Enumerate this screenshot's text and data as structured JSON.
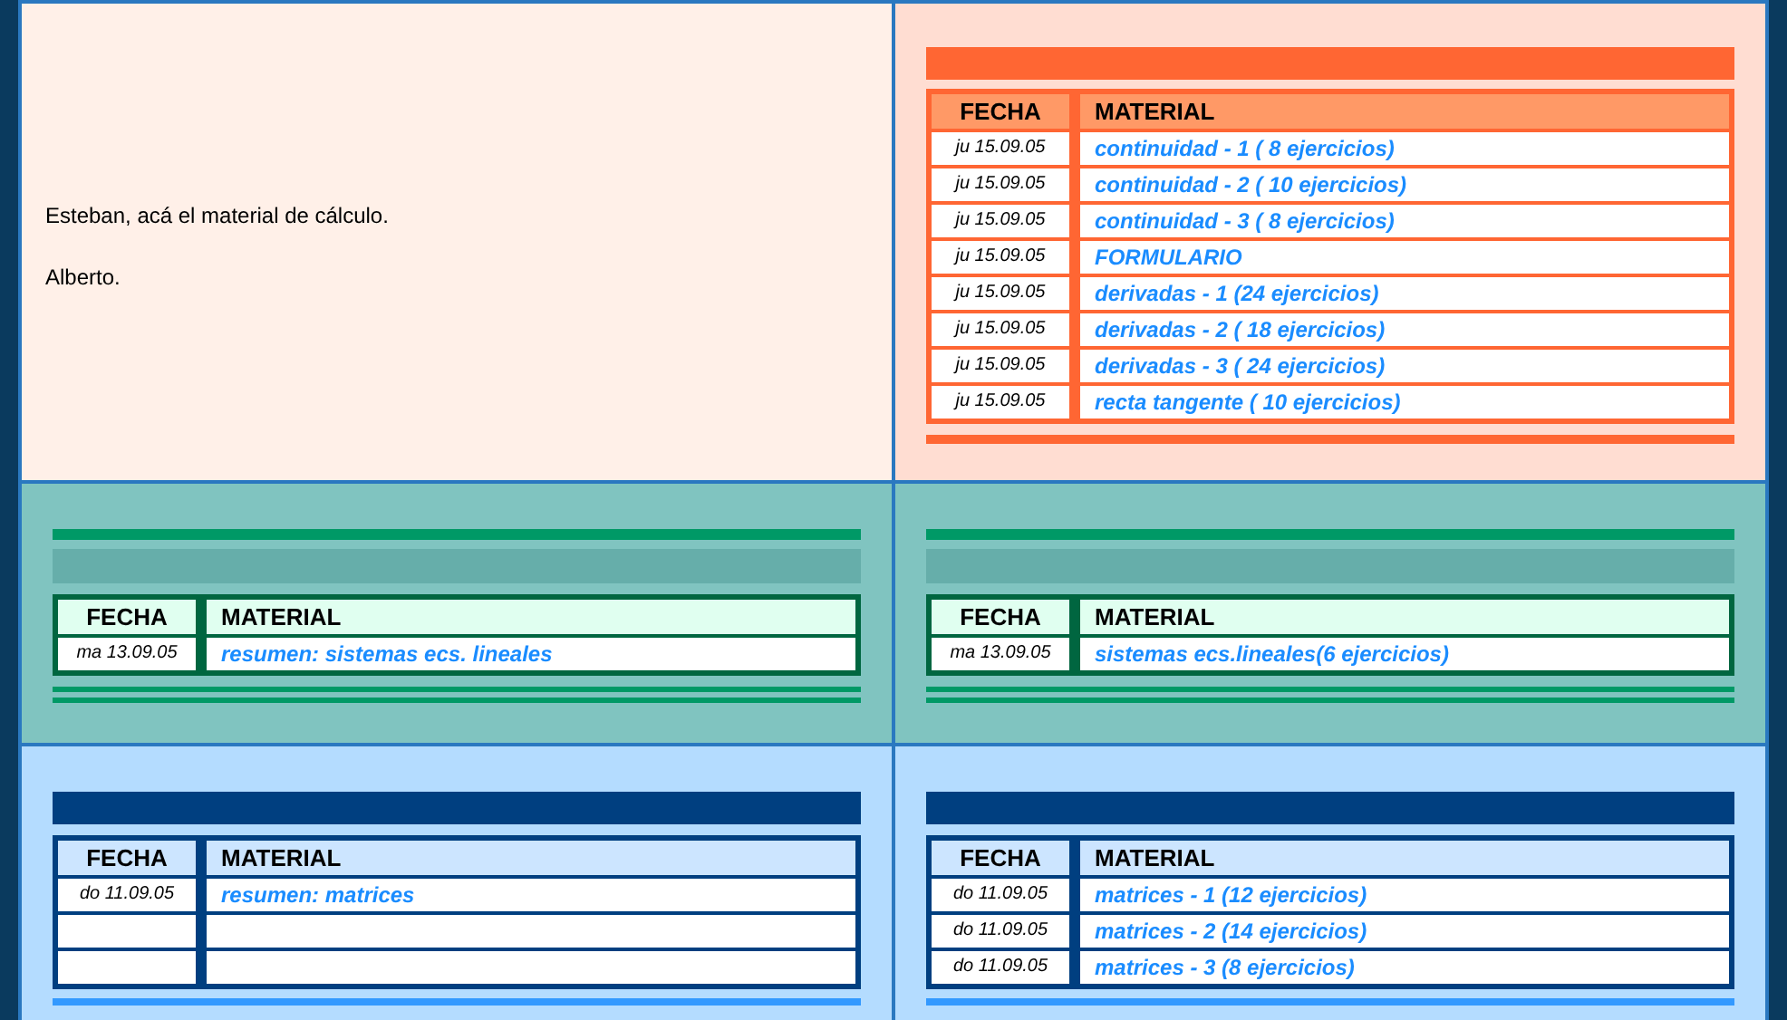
{
  "message": {
    "lines": [
      "Esteban, acá el material de cálculo.",
      "Alberto."
    ]
  },
  "panels": [
    {
      "kind": "orange",
      "columns": [
        "FECHA",
        "MATERIAL"
      ],
      "rows": [
        {
          "kind": "entry",
          "date": "ju 15.09.05",
          "material": "continuidad - 1 ( 8 ejercicios)"
        },
        {
          "kind": "entry",
          "date": "ju 15.09.05",
          "material": "continuidad - 2 ( 10 ejercicios)"
        },
        {
          "kind": "entry",
          "date": "ju 15.09.05",
          "material": "continuidad - 3 ( 8 ejercicios)"
        },
        {
          "kind": "entry",
          "date": "ju 15.09.05",
          "material": "FORMULARIO"
        },
        {
          "kind": "entry",
          "date": "ju 15.09.05",
          "material": "derivadas - 1 (24 ejercicios)"
        },
        {
          "kind": "entry",
          "date": "ju 15.09.05",
          "material": "derivadas - 2 ( 18 ejercicios)"
        },
        {
          "kind": "entry",
          "date": "ju 15.09.05",
          "material": "derivadas - 3 ( 24 ejercicios)"
        },
        {
          "kind": "entry",
          "date": "ju 15.09.05",
          "material": "recta tangente ( 10 ejercicios)"
        }
      ]
    },
    {
      "kind": "teal",
      "columns": [
        "FECHA",
        "MATERIAL"
      ],
      "rows": [
        {
          "kind": "entry",
          "date": "ma 13.09.05",
          "material": "resumen: sistemas ecs. lineales"
        }
      ]
    },
    {
      "kind": "teal",
      "columns": [
        "FECHA",
        "MATERIAL"
      ],
      "rows": [
        {
          "kind": "entry",
          "date": "ma 13.09.05",
          "material": "sistemas ecs.lineales(6 ejercicios)"
        }
      ]
    },
    {
      "kind": "blue",
      "columns": [
        "FECHA",
        "MATERIAL"
      ],
      "rows": [
        {
          "kind": "entry",
          "date": "do 11.09.05",
          "material": "resumen: matrices"
        },
        {
          "kind": "empty"
        },
        {
          "kind": "empty"
        }
      ]
    },
    {
      "kind": "blue",
      "columns": [
        "FECHA",
        "MATERIAL"
      ],
      "rows": [
        {
          "kind": "entry",
          "date": "do 11.09.05",
          "material": "matrices - 1 (12 ejercicios)"
        },
        {
          "kind": "entry",
          "date": "do 11.09.05",
          "material": "matrices - 2 (14 ejercicios)"
        },
        {
          "kind": "entry",
          "date": "do 11.09.05",
          "material": "matrices - 3 (8 ejercicios)"
        }
      ]
    }
  ]
}
